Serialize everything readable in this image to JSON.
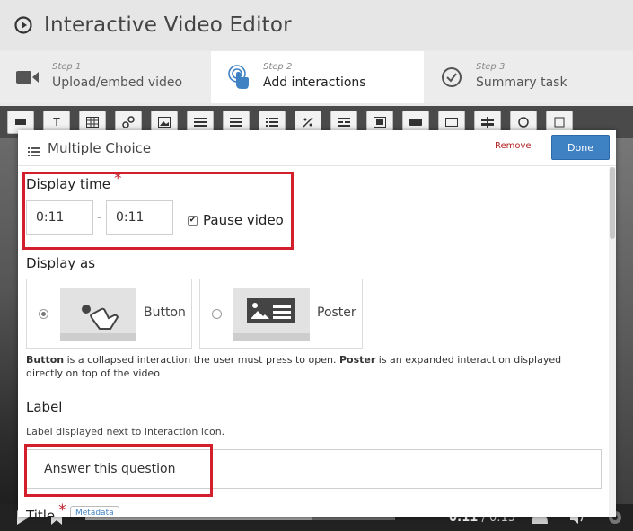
{
  "app": {
    "title": "Interactive Video Editor",
    "logo_icon": "play-circle-icon"
  },
  "steps": [
    {
      "number": "Step 1",
      "label": "Upload/embed video",
      "icon": "video-camera-icon",
      "active": false
    },
    {
      "number": "Step 2",
      "label": "Add interactions",
      "icon": "touch-hand-icon",
      "active": true
    },
    {
      "number": "Step 3",
      "label": "Summary task",
      "icon": "check-circle-icon",
      "active": false
    }
  ],
  "toolbar": {
    "buttons": [
      "label",
      "text",
      "table",
      "link",
      "image",
      "statements",
      "single-choice",
      "multiple-choice",
      "true-false",
      "fill-blanks",
      "drag-drop",
      "mark-words",
      "drag-text",
      "crossroads",
      "navigation-hotspot",
      "questionnaire"
    ],
    "text_glyph": "T"
  },
  "dialog": {
    "title": "Multiple Choice",
    "remove_label": "Remove",
    "done_label": "Done",
    "display_time": {
      "label": "Display time",
      "required_mark": "*",
      "from": "0:11",
      "separator": "-",
      "to": "0:11",
      "pause_label": "Pause video",
      "pause_checked": true,
      "check_glyph": "✔"
    },
    "display_as": {
      "label": "Display as",
      "options": [
        {
          "name": "Button",
          "selected": true
        },
        {
          "name": "Poster",
          "selected": false
        }
      ],
      "description_parts": [
        "Button",
        " is a collapsed interaction the user must press to open. ",
        "Poster",
        " is an expanded interaction displayed directly on top of the video"
      ]
    },
    "label_field": {
      "label": "Label",
      "help": "Label displayed next to interaction icon.",
      "value": "Answer this question"
    },
    "title_field": {
      "label": "Title",
      "required_mark": "*",
      "metadata_label": "Metadata"
    }
  },
  "player": {
    "current_time": "0:11",
    "separator": " / ",
    "duration": "0:15",
    "progress": 0.73
  },
  "colors": {
    "accent": "#3f82c4",
    "highlight_red": "#d31f2b",
    "required": "#c0202a"
  }
}
